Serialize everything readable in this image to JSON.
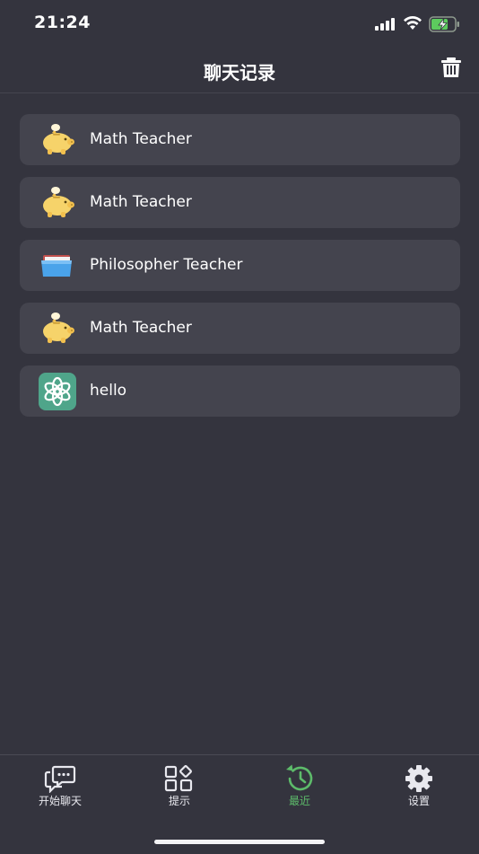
{
  "status_bar": {
    "time": "21:24"
  },
  "nav": {
    "title": "聊天记录"
  },
  "chats": [
    {
      "name": "Math Teacher",
      "avatar": "piggy-bank-icon"
    },
    {
      "name": "Math Teacher",
      "avatar": "piggy-bank-icon"
    },
    {
      "name": "Philosopher Teacher",
      "avatar": "folder-icon"
    },
    {
      "name": "Math Teacher",
      "avatar": "piggy-bank-icon"
    },
    {
      "name": "hello",
      "avatar": "openai-logo-icon"
    }
  ],
  "tabs": [
    {
      "label": "开始聊天",
      "icon": "chat-bubbles-icon",
      "active": false
    },
    {
      "label": "提示",
      "icon": "grid-shapes-icon",
      "active": false
    },
    {
      "label": "最近",
      "icon": "history-clock-icon",
      "active": true
    },
    {
      "label": "设置",
      "icon": "gear-icon",
      "active": false
    }
  ],
  "colors": {
    "background": "#34343e",
    "card": "#44444e",
    "accent": "#5dbb6a"
  }
}
